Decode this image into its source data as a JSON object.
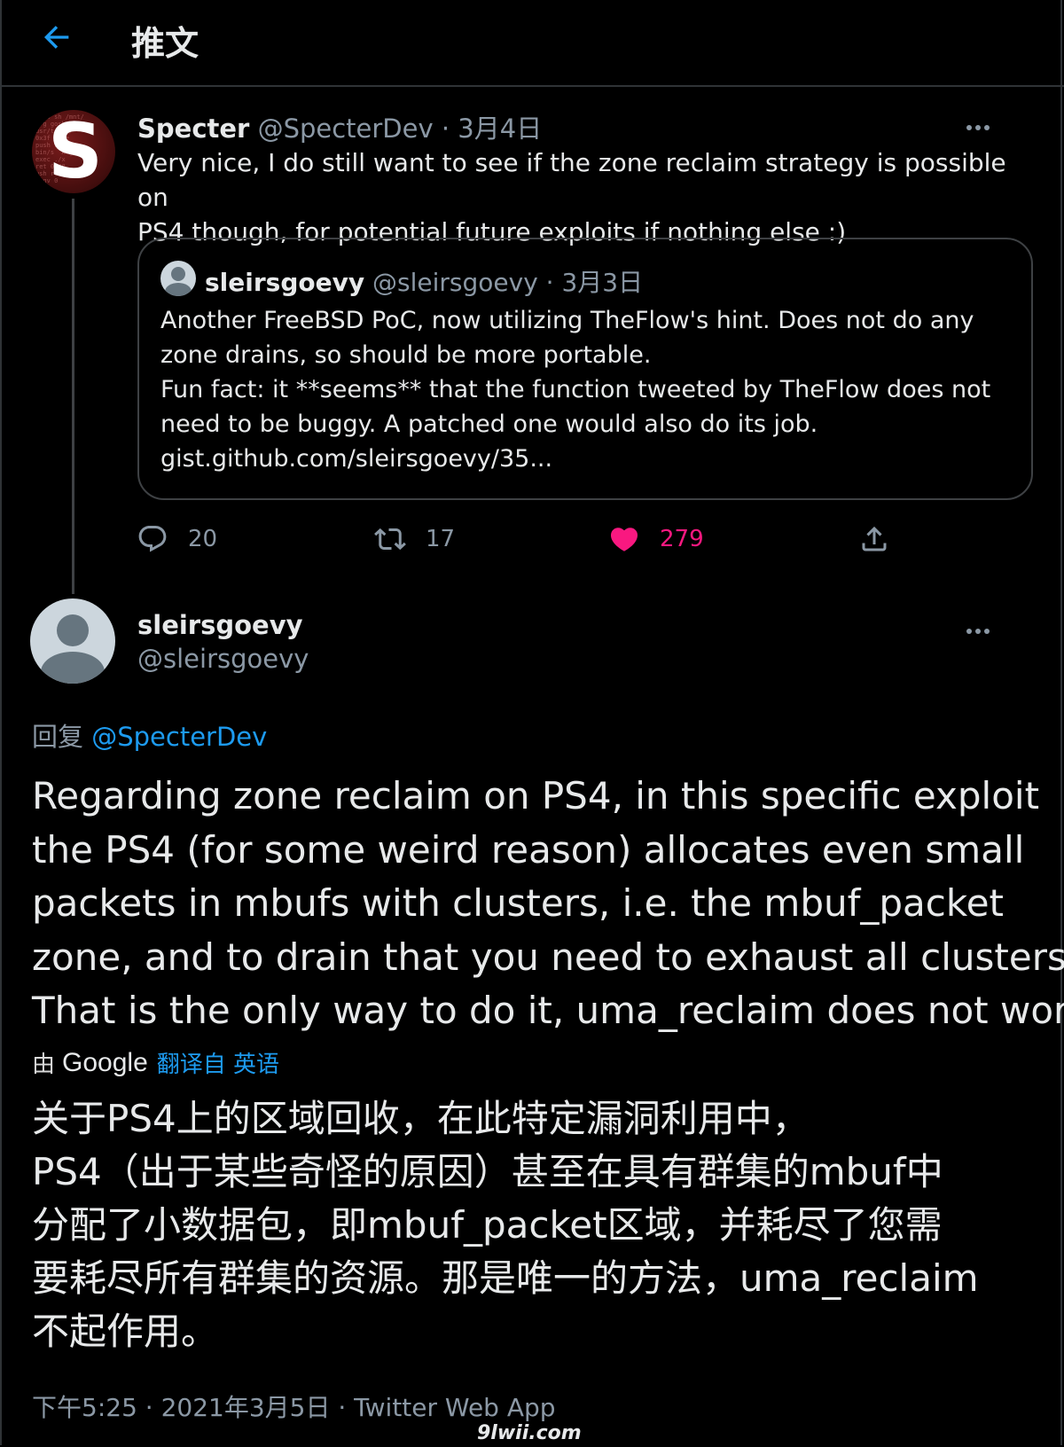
{
  "header": {
    "title": "推文"
  },
  "parent_tweet": {
    "display_name": "Specter",
    "handle": "@SpecterDev",
    "separator": "·",
    "date": "3月4日",
    "avatar_letter": "S",
    "text_lines": [
      "Very nice, I do still want to see if the zone reclaim strategy is possible on",
      "PS4 though, for potential future exploits if nothing else :)"
    ],
    "quote": {
      "display_name": "sleirsgoevy",
      "handle": "@sleirsgoevy",
      "separator": "·",
      "date": "3月3日",
      "lines": [
        "Another FreeBSD PoC, now utilizing TheFlow's hint. Does not do any",
        "zone drains, so should be more portable.",
        "Fun fact: it **seems** that the function tweeted by TheFlow does not",
        "need to be buggy. A patched one would also do its job.",
        "gist.github.com/sleirsgoevy/35..."
      ]
    },
    "actions": {
      "replies": "20",
      "retweets": "17",
      "likes": "279"
    }
  },
  "main_tweet": {
    "display_name": "sleirsgoevy",
    "handle": "@sleirsgoevy",
    "reply_prefix": "回复",
    "reply_handle": "@SpecterDev",
    "text_lines": [
      "Regarding zone reclaim on PS4, in this specific exploit",
      "the PS4 (for some weird reason) allocates even small",
      "packets in mbufs with clusters, i.e. the mbuf_packet",
      "zone, and to drain that you need to exhaust all clusters.",
      "That is the only way to do it, uma_reclaim does not work."
    ],
    "translation_by_prefix": "由",
    "translation_provider": "Google",
    "translation_link": "翻译自 英语",
    "translated_lines": [
      "关于PS4上的区域回收，在此特定漏洞利用中，",
      "PS4（出于某些奇怪的原因）甚至在具有群集的mbuf中",
      "分配了小数据包，即mbuf_packet区域，并耗尽了您需",
      "要耗尽所有群集的资源。那是唯一的方法，uma_reclaim",
      "不起作用。"
    ],
    "meta": "下午5:25 · 2021年3月5日 · Twitter Web App"
  },
  "watermark": "9lwii.com",
  "colors": {
    "accent": "#1d9bf0",
    "like": "#f91880",
    "muted": "#8b98a5",
    "background": "#000000"
  }
}
